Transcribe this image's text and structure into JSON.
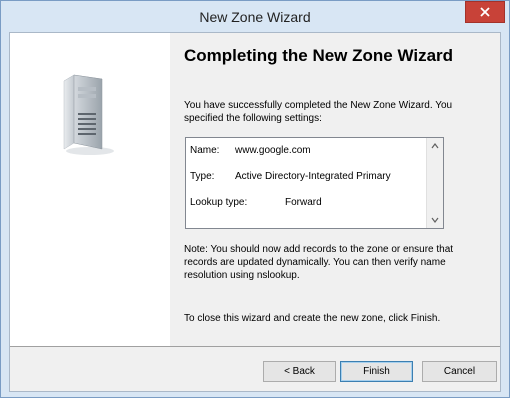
{
  "window": {
    "title": "New Zone Wizard"
  },
  "page": {
    "heading": "Completing the New Zone Wizard",
    "intro": "You have successfully completed the New Zone Wizard. You specified the following settings:",
    "settings": [
      {
        "label": "Name:",
        "value": "www.google.com"
      },
      {
        "label": "Type:",
        "value": "Active Directory-Integrated Primary"
      },
      {
        "label": "Lookup type:",
        "value": "Forward"
      }
    ],
    "note": "Note: You should now add records to the zone or ensure that records are updated dynamically. You can then verify name resolution using nslookup.",
    "closing": "To close this wizard and create the new zone, click Finish."
  },
  "buttons": {
    "back": "< Back",
    "finish": "Finish",
    "cancel": "Cancel"
  },
  "icons": {
    "close": "close-icon",
    "server": "server-icon",
    "scroll_up": "scroll-up-arrow-icon",
    "scroll_down": "scroll-down-arrow-icon"
  },
  "colors": {
    "close_button": "#c84238",
    "titlebar": "#d8e6f4"
  }
}
